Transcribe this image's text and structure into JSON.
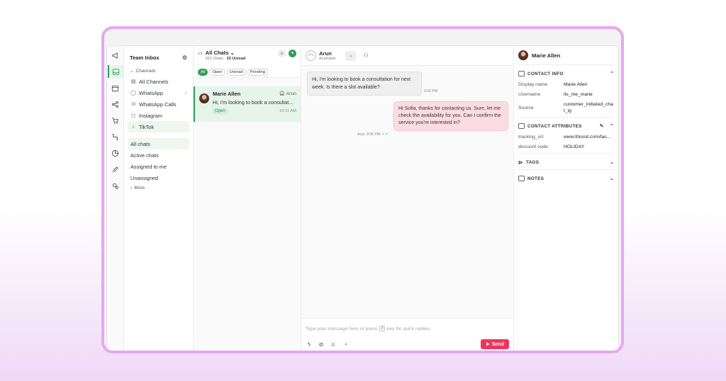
{
  "inbox": {
    "title": "Team Inbox",
    "channels_label": "Channels",
    "channels": [
      {
        "label": "All Channels",
        "icon": "inbox-icon"
      },
      {
        "label": "WhatsApp",
        "icon": "whatsapp-icon"
      },
      {
        "label": "WhatsApp Calls",
        "icon": "phone-icon"
      },
      {
        "label": "Instagram",
        "icon": "instagram-icon"
      },
      {
        "label": "TikTok",
        "icon": "tiktok-icon"
      }
    ],
    "filters": [
      "All chats",
      "Active chats",
      "Assigned to me",
      "Unassigned"
    ],
    "more_label": "More"
  },
  "chatlist": {
    "title": "All Chats",
    "count_text": "322 Chats",
    "unread_text": "23 Unread",
    "chips": [
      "All",
      "Open",
      "Unread",
      "Pending"
    ],
    "conversation": {
      "name": "Marie Allen",
      "agent": "Arun",
      "preview": "Hi, I'm looking to book a consultat...",
      "status": "Open",
      "time": "10:11 AM"
    }
  },
  "conversation": {
    "agent_name": "Arun",
    "agent_status": "Available",
    "incoming": {
      "text": "Hi, I'm looking to book a consultation for next week. Is there a slot available?",
      "time": "9:05 PM"
    },
    "outgoing": {
      "text": "Hi Sofia, thanks for contacting us. Sure, let me check the availability for you. Can I confirm the service you're interested in?",
      "sender": "Arun",
      "time": "9:06 PM"
    },
    "composer": {
      "placeholder_before": "Type your message here or press",
      "key": "/",
      "placeholder_after": "key for quick replies.",
      "send_label": "Send"
    }
  },
  "contact": {
    "name": "Marie Allen",
    "info_title": "CONTACT INFO",
    "info": [
      {
        "key": "Display name",
        "value": "Marie Allen"
      },
      {
        "key": "Username",
        "value": "its_me_marie"
      },
      {
        "key": "Source",
        "value": "customer_initiated_chat_ig"
      }
    ],
    "attributes_title": "CONTACT ATTRIBUTES",
    "attributes": [
      {
        "key": "tracking_url",
        "value": "www.thisisit.com/tac..."
      },
      {
        "key": "discount code",
        "value": "HOLIDAY"
      }
    ],
    "tags_title": "TAGS",
    "notes_title": "NOTES"
  },
  "colors": {
    "accent_green": "#2f9e57",
    "send_red": "#f0345a",
    "outgoing_bubble": "#fcdce4",
    "frame_border": "#e9a6f3"
  }
}
